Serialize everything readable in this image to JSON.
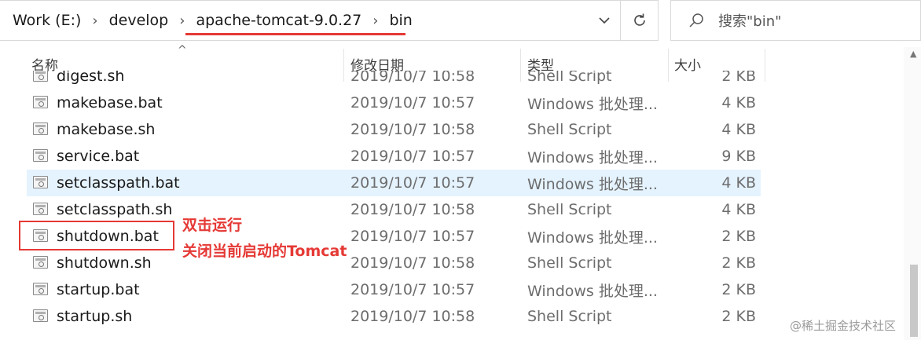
{
  "address_bar": {
    "breadcrumbs": [
      "Work (E:)",
      "develop",
      "apache-tomcat-9.0.27",
      "bin"
    ],
    "separator": "›"
  },
  "search": {
    "placeholder": "搜索\"bin\""
  },
  "columns": {
    "name": "名称",
    "date": "修改日期",
    "type": "类型",
    "size": "大小"
  },
  "partial_row": {
    "name": "digest.sh",
    "date": "2019/10/7 10:58",
    "type": "Shell Script",
    "size": "2 KB"
  },
  "files": [
    {
      "name": "makebase.bat",
      "date": "2019/10/7 10:57",
      "type": "Windows 批处理...",
      "size": "4 KB"
    },
    {
      "name": "makebase.sh",
      "date": "2019/10/7 10:58",
      "type": "Shell Script",
      "size": "4 KB"
    },
    {
      "name": "service.bat",
      "date": "2019/10/7 10:57",
      "type": "Windows 批处理...",
      "size": "9 KB"
    },
    {
      "name": "setclasspath.bat",
      "date": "2019/10/7 10:57",
      "type": "Windows 批处理...",
      "size": "4 KB",
      "selected": true
    },
    {
      "name": "setclasspath.sh",
      "date": "2019/10/7 10:58",
      "type": "Shell Script",
      "size": "4 KB"
    },
    {
      "name": "shutdown.bat",
      "date": "2019/10/7 10:57",
      "type": "Windows 批处理...",
      "size": "2 KB"
    },
    {
      "name": "shutdown.sh",
      "date": "2019/10/7 10:58",
      "type": "Shell Script",
      "size": "2 KB"
    },
    {
      "name": "startup.bat",
      "date": "2019/10/7 10:57",
      "type": "Windows 批处理...",
      "size": "2 KB"
    },
    {
      "name": "startup.sh",
      "date": "2019/10/7 10:58",
      "type": "Shell Script",
      "size": "2 KB"
    }
  ],
  "annotation": {
    "line1": "双击运行",
    "line2": "关闭当前启动的Tomcat"
  },
  "watermark": "@稀土掘金技术社区",
  "colors": {
    "annotation": "#e53935",
    "selection": "#e5f3ff"
  }
}
